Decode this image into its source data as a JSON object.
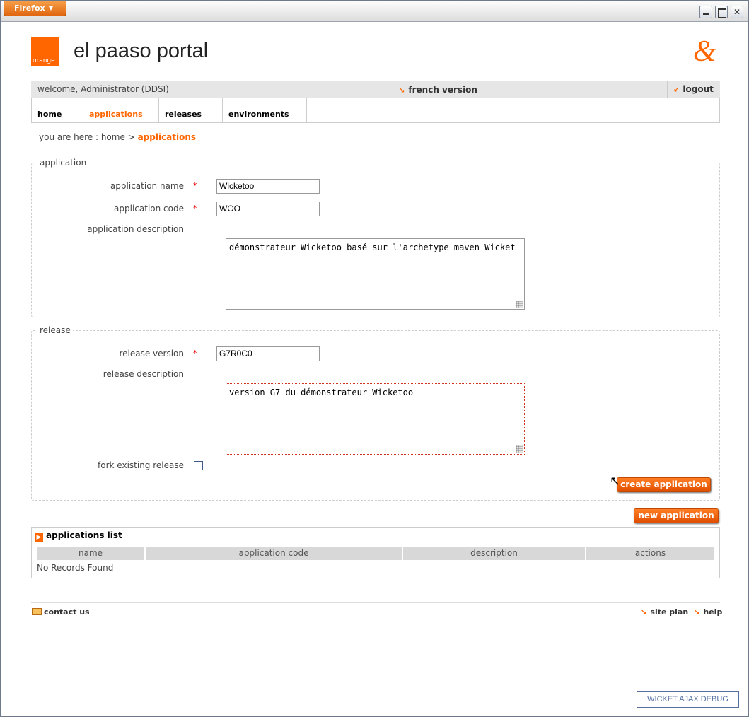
{
  "browser": {
    "menu_label": "Firefox"
  },
  "header": {
    "logo_text": "orange",
    "title": "el paaso portal"
  },
  "topbar": {
    "welcome": "welcome, Administrator (DDSI)",
    "language_link": "french version",
    "logout": "logout"
  },
  "nav": {
    "tabs": [
      {
        "label": "home"
      },
      {
        "label": "applications"
      },
      {
        "label": "releases"
      },
      {
        "label": "environments"
      }
    ],
    "active_tab": "applications"
  },
  "breadcrumb": {
    "prefix": "you are here :",
    "home": "home",
    "separator": ">",
    "current": "applications"
  },
  "application_form": {
    "legend": "application",
    "name_label": "application name",
    "name_value": "Wicketoo",
    "code_label": "application code",
    "code_value": "WOO",
    "description_label": "application description",
    "description_value": "démonstrateur Wicketoo basé sur l'archetype maven Wicket",
    "required_mark": "*"
  },
  "release_form": {
    "legend": "release",
    "version_label": "release version",
    "version_value": "G7R0C0",
    "description_label": "release description",
    "description_value": "version G7 du démonstrateur Wicketoo",
    "fork_label": "fork existing release",
    "fork_checked": false
  },
  "buttons": {
    "create": "create application",
    "new": "new application"
  },
  "applications_list": {
    "title": "applications list",
    "columns": [
      "name",
      "application code",
      "description",
      "actions"
    ],
    "empty_message": "No Records Found"
  },
  "footer": {
    "contact": "contact us",
    "site_plan": "site plan",
    "help": "help"
  },
  "debug": {
    "label": "WICKET AJAX DEBUG"
  },
  "colors": {
    "accent": "#ff6600"
  }
}
